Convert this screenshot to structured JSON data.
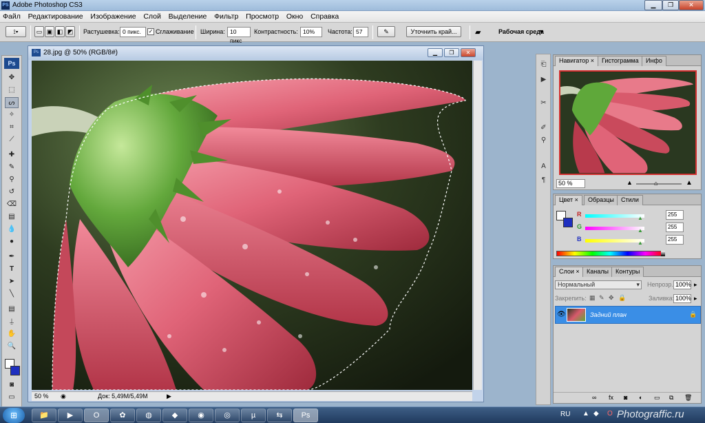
{
  "window": {
    "title": "Adobe Photoshop CS3",
    "app_icon": "PS"
  },
  "menu": [
    "Файл",
    "Редактирование",
    "Изображение",
    "Слой",
    "Выделение",
    "Фильтр",
    "Просмотр",
    "Окно",
    "Справка"
  ],
  "options": {
    "feather_label": "Растушевка:",
    "feather_value": "0 пикс.",
    "antialias_label": "Сглаживание",
    "antialias_checked": true,
    "width_label": "Ширина:",
    "width_value": "10 пикс",
    "contrast_label": "Контрастность:",
    "contrast_value": "10%",
    "frequency_label": "Частота:",
    "frequency_value": "57",
    "refine_edge_label": "Уточнить край...",
    "workspace_label": "Рабочая среда"
  },
  "toolbox": {
    "badge": "Ps"
  },
  "document": {
    "title": "28.jpg @ 50% (RGB/8#)",
    "zoom": "50 %",
    "doc_info": "Док: 5,49M/5,49M"
  },
  "navigator": {
    "tabs": [
      "Навигатор",
      "Гистограмма",
      "Инфо"
    ],
    "zoom": "50 %"
  },
  "color": {
    "tabs": [
      "Цвет",
      "Образцы",
      "Стили"
    ],
    "r_label": "R",
    "g_label": "G",
    "b_label": "B",
    "r": "255",
    "g": "255",
    "b": "255"
  },
  "layers": {
    "tabs": [
      "Слои",
      "Каналы",
      "Контуры"
    ],
    "blend_mode": "Нормальный",
    "opacity_label": "Непрозр.:",
    "opacity": "100%",
    "lock_label": "Закрепить:",
    "fill_label": "Заливка:",
    "fill": "100%",
    "layer_name": "Задний план"
  },
  "taskbar": {
    "lang": "RU",
    "watermark": "Photograffic.ru"
  },
  "colors": {
    "layer_highlight": "#3a8ee6",
    "petal": "#d95a6e",
    "sepal": "#5fa83a"
  }
}
